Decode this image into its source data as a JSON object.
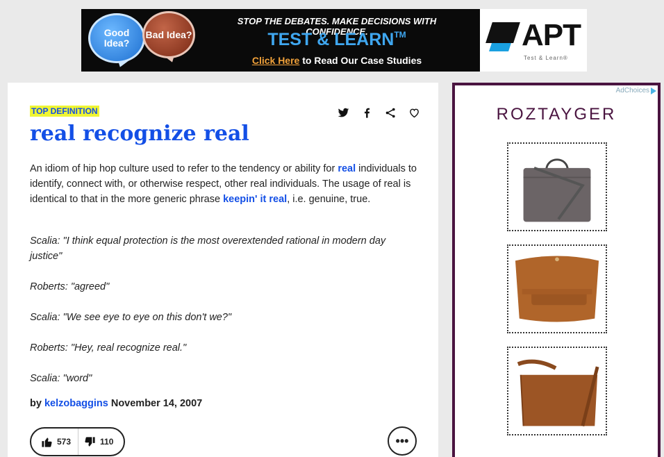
{
  "top_ad": {
    "bubble_good": "Good Idea?",
    "bubble_bad": "Bad Idea?",
    "headline": "STOP THE DEBATES. MAKE DECISIONS WITH CONFIDENCE.",
    "product": "TEST & LEARN",
    "product_tm": "TM",
    "cta_link": "Click Here",
    "cta_rest": " to Read Our Case Studies",
    "brand": "APT",
    "brand_sub": "Test & Learn®",
    "colors": {
      "accent": "#3fa7f0",
      "cta": "#f2a23a"
    }
  },
  "definition": {
    "badge": "TOP DEFINITION",
    "word": "real recognize real",
    "meaning": {
      "part1": "An idiom of hip hop culture used to refer to the tendency or ability for ",
      "link1": "real",
      "part2": " individuals to identify, connect with, or otherwise respect, other real individuals. The usage of real is identical to that in the more generic phrase ",
      "link2": "keepin' it real",
      "part3": ", i.e. genuine, true."
    },
    "example": [
      "Scalia: \"I think equal protection is the most overextended rational in modern day justice\"",
      "Roberts: \"agreed\"",
      "Scalia: \"We see eye to eye on this don't we?\"",
      "Roberts: \"Hey, real recognize real.\"",
      "Scalia: \"word\""
    ],
    "by_label": "by",
    "author": "kelzobaggins",
    "date": "November 14, 2007",
    "upvotes": "573",
    "downvotes": "110",
    "more_label": "•••",
    "share_icons": [
      "twitter-icon",
      "facebook-icon",
      "share-icon",
      "heart-icon"
    ],
    "colors": {
      "link": "#134fe6",
      "badge_bg": "#eff533"
    }
  },
  "side_ad": {
    "adchoices": "AdChoices",
    "brand": "ROZTAYGER",
    "products": [
      "grey-tote-bag",
      "tan-clutch-bag",
      "brown-messenger-bag"
    ],
    "colors": {
      "frame": "#4a1440"
    }
  }
}
